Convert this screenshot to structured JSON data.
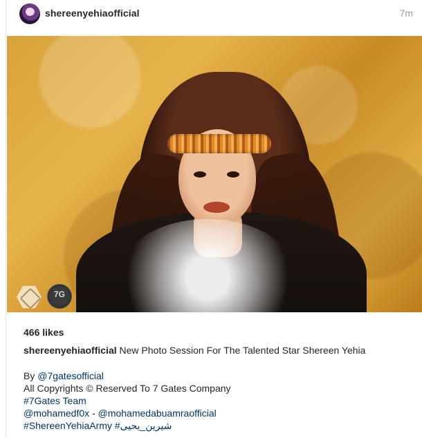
{
  "post": {
    "username": "shereenyehiaofficial",
    "time": "7m"
  },
  "photo": {
    "watermark_badge_text": "7G"
  },
  "likes": "466 likes",
  "caption": {
    "user": "shereenyehiaofficial",
    "text": "New Photo Session For The Talented Star Shereen Yehia"
  },
  "lines": {
    "by_prefix": "By ",
    "by_link": "@7gatesofficial",
    "copyright": "All Copyrights © Reserved To 7 Gates Company",
    "team": "#7Gates Team",
    "mention1": "@mohamedf0x",
    "mention_sep": " - ",
    "mention2": "@mohamedabuamraofficial",
    "tag1": "#ShereenYehiaArmy",
    "tag_sep": " ",
    "tag2": "#شيرين_يحيى"
  }
}
